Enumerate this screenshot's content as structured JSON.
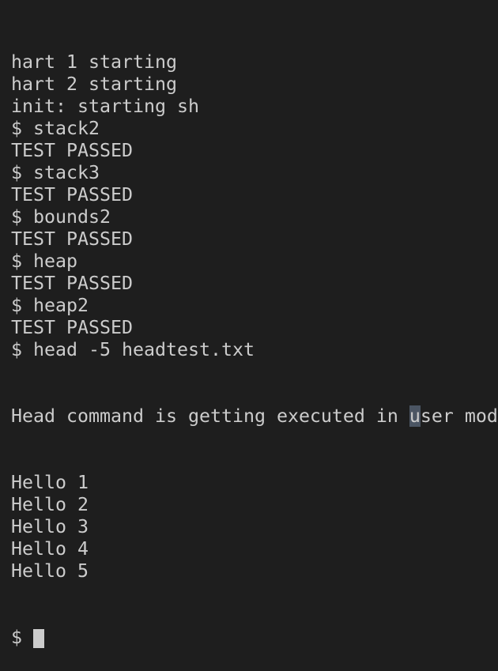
{
  "terminal": {
    "lines": [
      "hart 1 starting",
      "hart 2 starting",
      "init: starting sh",
      "$ stack2",
      "TEST PASSED",
      "$ stack3",
      "TEST PASSED",
      "$ bounds2",
      "TEST PASSED",
      "$ heap",
      "TEST PASSED",
      "$ heap2",
      "TEST PASSED",
      "$ head -5 headtest.txt"
    ],
    "highlight_line": {
      "before": "Head command is getting executed in ",
      "selected": "u",
      "after": "ser mode"
    },
    "after_lines": [
      "Hello 1",
      "Hello 2",
      "Hello 3",
      "Hello 4",
      "Hello 5"
    ],
    "prompt": "$ ",
    "colors": {
      "background": "#1e1e1e",
      "text": "#cccccc",
      "selection": "#4b5563",
      "cursor": "#cccccc"
    }
  }
}
